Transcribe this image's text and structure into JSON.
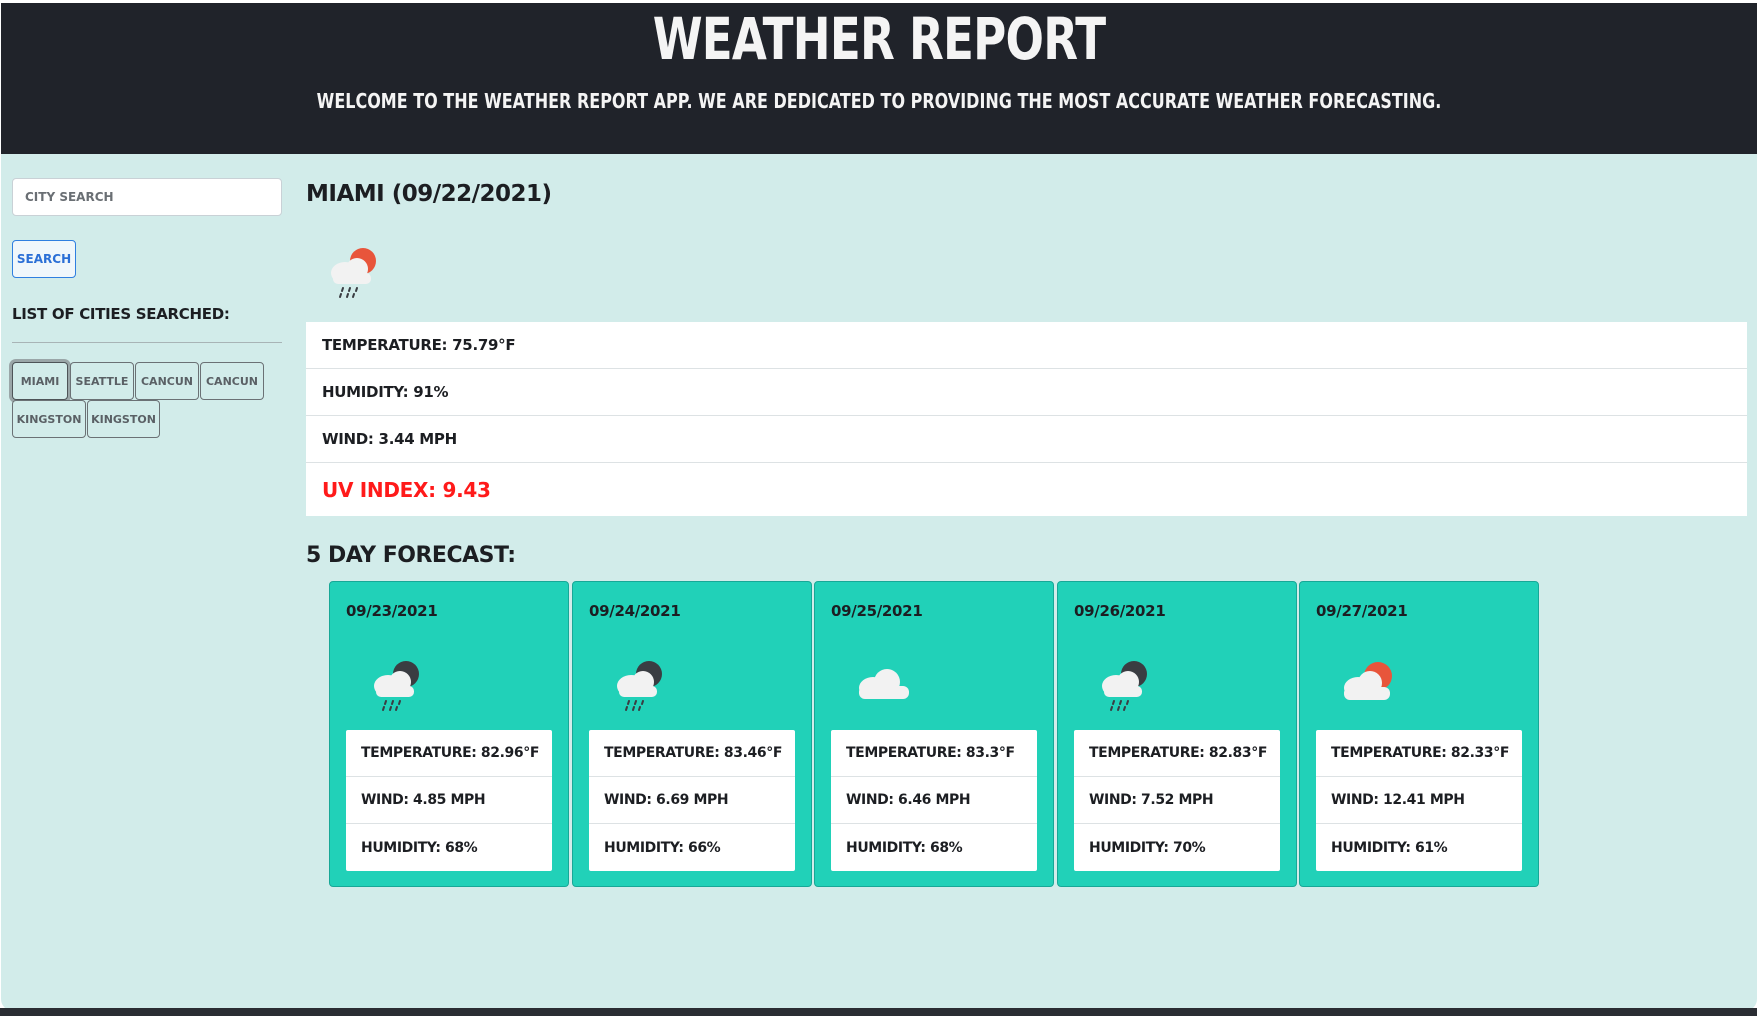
{
  "header": {
    "title": "Weather Report",
    "subtitle": "Welcome to the weather report app. We are dedicated to providing the most accurate weather forecasting."
  },
  "sidebar": {
    "search_placeholder": "City Search",
    "search_button": "Search",
    "list_label": "List of Cities Searched:",
    "cities": [
      {
        "label": "Miami",
        "active": true
      },
      {
        "label": "Seattle",
        "active": false
      },
      {
        "label": "Cancun",
        "active": false
      },
      {
        "label": "Cancun",
        "active": false
      },
      {
        "label": "Kingston",
        "active": false
      },
      {
        "label": "Kingston",
        "active": false
      }
    ]
  },
  "current": {
    "title": "Miami (09/22/2021)",
    "icon": "rain-cloud-sun-icon",
    "temperature": "Temperature: 75.79°F",
    "humidity": "Humidity: 91%",
    "wind": "Wind: 3.44 MPH",
    "uv": "UV Index: 9.43",
    "uv_color": "#ff1a1a"
  },
  "forecast": {
    "title": "5 Day Forecast:",
    "days": [
      {
        "date": "09/23/2021",
        "icon": "rain-cloud-moon-icon",
        "temperature": "Temperature: 82.96°F",
        "wind": "Wind: 4.85 MPH",
        "humidity": "Humidity: 68%"
      },
      {
        "date": "09/24/2021",
        "icon": "rain-cloud-moon-icon",
        "temperature": "Temperature: 83.46°F",
        "wind": "Wind: 6.69 MPH",
        "humidity": "Humidity: 66%"
      },
      {
        "date": "09/25/2021",
        "icon": "cloud-icon",
        "temperature": "Temperature: 83.3°F",
        "wind": "Wind: 6.46 MPH",
        "humidity": "Humidity: 68%"
      },
      {
        "date": "09/26/2021",
        "icon": "rain-cloud-moon-icon",
        "temperature": "Temperature: 82.83°F",
        "wind": "Wind: 7.52 MPH",
        "humidity": "Humidity: 70%"
      },
      {
        "date": "09/27/2021",
        "icon": "cloud-sun-icon",
        "temperature": "Temperature: 82.33°F",
        "wind": "Wind: 12.41 MPH",
        "humidity": "Humidity: 61%"
      }
    ]
  },
  "colors": {
    "header_bg": "#20232a",
    "page_bg": "#d2ecea",
    "card_bg": "#21d1b8",
    "sun": "#e8553b",
    "moon": "#3a3d42"
  }
}
